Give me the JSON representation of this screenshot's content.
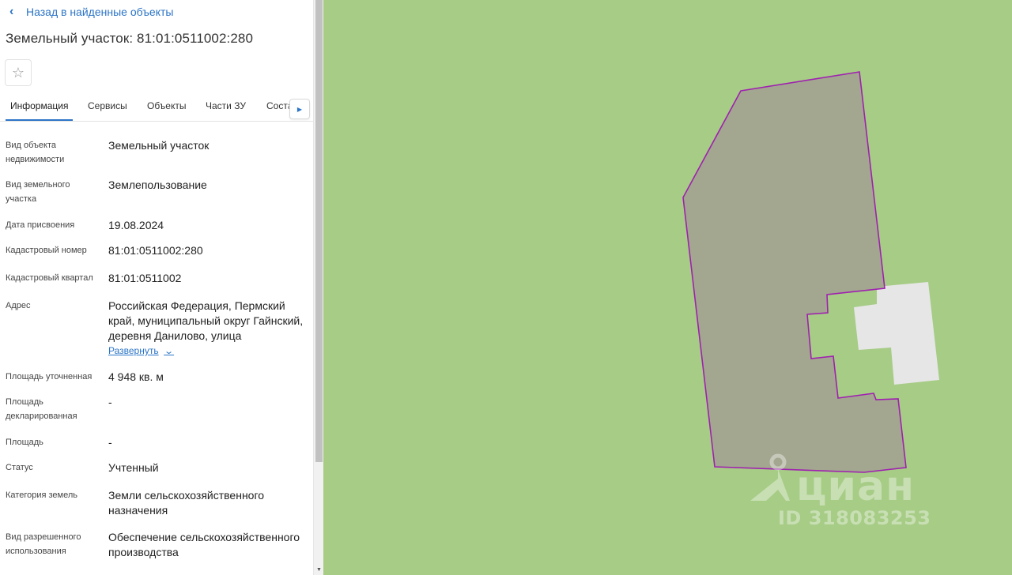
{
  "back_link": {
    "label": "Назад в найденные объекты"
  },
  "title": "Земельный участок: 81:01:0511002:280",
  "tabs": [
    {
      "label": "Информация",
      "active": true
    },
    {
      "label": "Сервисы"
    },
    {
      "label": "Объекты"
    },
    {
      "label": "Части ЗУ"
    },
    {
      "label": "Соста"
    }
  ],
  "details": [
    {
      "label": "Вид объекта недвижимости",
      "value": "Земельный участок"
    },
    {
      "label": "Вид земельного участка",
      "value": "Землепользование"
    },
    {
      "label": "Дата присвоения",
      "value": "19.08.2024"
    },
    {
      "label": "Кадастровый номер",
      "value": "81:01:0511002:280"
    },
    {
      "label": "Кадастровый квартал",
      "value": "81:01:0511002"
    },
    {
      "label": "Адрес",
      "value": "Российская Федерация, Пермский край, муниципальный округ Гайнский, деревня Данилово, улица",
      "expand_label": "Развернуть"
    },
    {
      "label": "Площадь уточненная",
      "value": "4 948 кв. м"
    },
    {
      "label": "Площадь декларированная",
      "value": "-"
    },
    {
      "label": "Площадь",
      "value": "-"
    },
    {
      "label": "Статус",
      "value": "Учтенный"
    },
    {
      "label": "Категория земель",
      "value": "Земли сельскохозяйственного назначения"
    },
    {
      "label": "Вид разрешенного использования",
      "value": "Обеспечение сельскохозяйственного производства"
    }
  ],
  "map": {
    "background_color": "#a6cc86",
    "parcel_fill": "#a3a78f",
    "parcel_stroke": "#a020b0",
    "building_fill": "#e6e6e6"
  },
  "watermark": {
    "brand": "циан",
    "id": "ID 318083253"
  }
}
